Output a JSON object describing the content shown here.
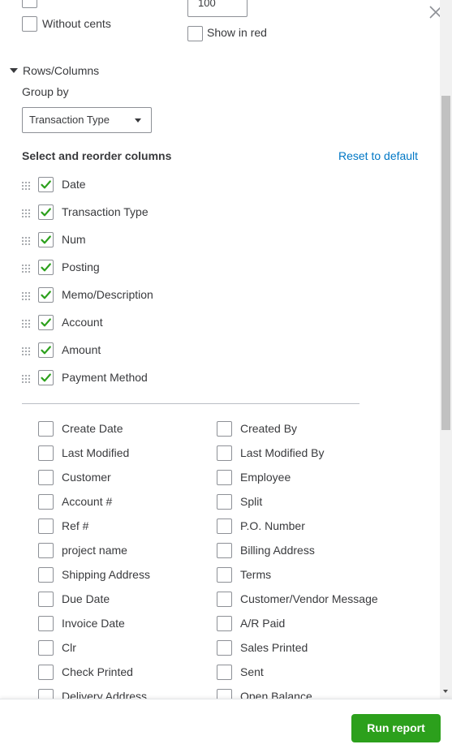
{
  "top": {
    "without_cents_label": "Without cents",
    "show_in_red_label": "Show in red",
    "partial_select_value": "100"
  },
  "rows_columns": {
    "section_label": "Rows/Columns",
    "group_by_label": "Group by",
    "group_by_value": "Transaction Type"
  },
  "columns": {
    "heading": "Select and reorder columns",
    "reset_label": "Reset to default",
    "selected": [
      {
        "label": "Date",
        "checked": true
      },
      {
        "label": "Transaction Type",
        "checked": true
      },
      {
        "label": "Num",
        "checked": true
      },
      {
        "label": "Posting",
        "checked": true
      },
      {
        "label": "Memo/Description",
        "checked": true
      },
      {
        "label": "Account",
        "checked": true
      },
      {
        "label": "Amount",
        "checked": true
      },
      {
        "label": "Payment Method",
        "checked": true
      }
    ],
    "available_left": [
      "Create Date",
      "Last Modified",
      "Customer",
      "Account #",
      "Ref #",
      "project name",
      "Shipping Address",
      "Due Date",
      "Invoice Date",
      "Clr",
      "Check Printed",
      "Delivery Address"
    ],
    "available_right": [
      "Created By",
      "Last Modified By",
      "Employee",
      "Split",
      "P.O. Number",
      "Billing Address",
      "Terms",
      "Customer/Vendor Message",
      "A/R Paid",
      "Sales Printed",
      "Sent",
      "Open Balance"
    ]
  },
  "footer": {
    "run_report_label": "Run report"
  },
  "colors": {
    "accent_green": "#2ca01c",
    "link_blue": "#0077c5",
    "text": "#393a3d"
  }
}
